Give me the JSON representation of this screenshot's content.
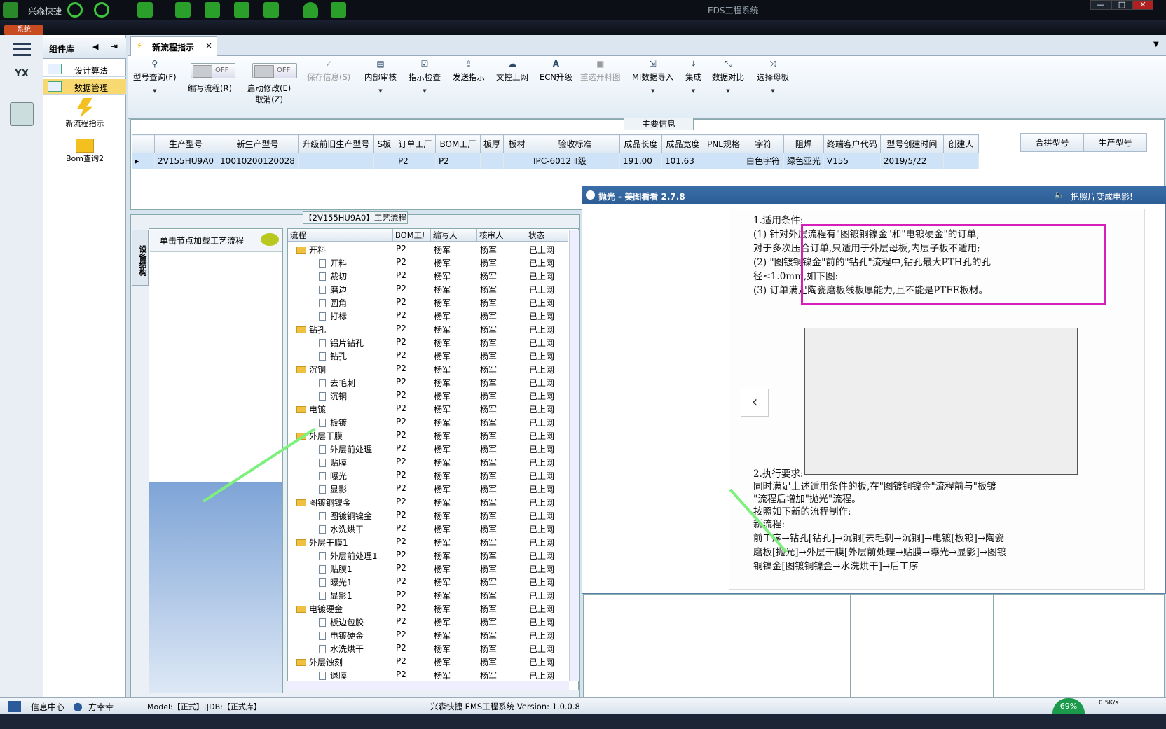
{
  "titlebar": {
    "brand": "兴森快捷",
    "app_title": "EDS工程系统",
    "win_min": "—",
    "win_max": "□",
    "win_close": "✕"
  },
  "menubar": {
    "system": "系统"
  },
  "sidebar": {
    "yx_label": "YX"
  },
  "component_panel": {
    "title": "组件库",
    "items": [
      {
        "label": "设计算法"
      },
      {
        "label": "数据管理"
      }
    ],
    "tools": [
      {
        "label": "新流程指示"
      },
      {
        "label": "Bom查询2"
      }
    ]
  },
  "tab": {
    "label": "新流程指示",
    "close": "×"
  },
  "toolbar": {
    "buttons": [
      {
        "label": "型号查询(F)"
      },
      {
        "label": "编写流程(R)",
        "toggle": "OFF"
      },
      {
        "label": "启动修改(E)",
        "sub": "取消(Z)",
        "toggle": "OFF"
      },
      {
        "label": "保存信息(S)"
      },
      {
        "label": "内部审核"
      },
      {
        "label": "指示检查"
      },
      {
        "label": "发送指示"
      },
      {
        "label": "文控上网"
      },
      {
        "label": "ECN升级"
      },
      {
        "label": "重选开料图"
      },
      {
        "label": "MI数据导入"
      },
      {
        "label": "集成"
      },
      {
        "label": "数据对比"
      },
      {
        "label": "选择母板"
      }
    ]
  },
  "main_info": {
    "label": "主要信息",
    "columns": [
      "生产型号",
      "新生产型号",
      "升级前旧生产型号",
      "S板",
      "订单工厂",
      "BOM工厂",
      "板厚",
      "板材",
      "验收标准",
      "成品长度",
      "成品宽度",
      "PNL规格",
      "字符",
      "阻焊",
      "终端客户代码",
      "型号创建时间",
      "创建人"
    ],
    "row": [
      "2V155HU9A0",
      "10010200120028",
      "",
      "",
      "P2",
      "P2",
      "",
      "",
      "IPC-6012 Ⅱ级",
      "191.00",
      "101.63",
      "",
      "白色字符",
      "绿色亚光",
      "V155",
      "2019/5/22",
      ""
    ],
    "side_columns": [
      "合拼型号",
      "生产型号"
    ]
  },
  "flow": {
    "label": "【2V155HU9A0】工艺流程",
    "vertical_tab": "设备结构",
    "hint": "单击节点加载工艺流程",
    "columns": [
      "流程",
      "BOM工厂",
      "编写人",
      "核审人",
      "状态"
    ],
    "rows": [
      {
        "name": "开料",
        "folder": true,
        "f": "P2",
        "w": "杨军",
        "c": "杨军",
        "s": "已上网"
      },
      {
        "name": "开料",
        "folder": false,
        "f": "P2",
        "w": "杨军",
        "c": "杨军",
        "s": "已上网"
      },
      {
        "name": "裁切",
        "folder": false,
        "f": "P2",
        "w": "杨军",
        "c": "杨军",
        "s": "已上网"
      },
      {
        "name": "磨边",
        "folder": false,
        "f": "P2",
        "w": "杨军",
        "c": "杨军",
        "s": "已上网"
      },
      {
        "name": "圆角",
        "folder": false,
        "f": "P2",
        "w": "杨军",
        "c": "杨军",
        "s": "已上网"
      },
      {
        "name": "打标",
        "folder": false,
        "f": "P2",
        "w": "杨军",
        "c": "杨军",
        "s": "已上网"
      },
      {
        "name": "钻孔",
        "folder": true,
        "f": "P2",
        "w": "杨军",
        "c": "杨军",
        "s": "已上网"
      },
      {
        "name": "铝片钻孔",
        "folder": false,
        "f": "P2",
        "w": "杨军",
        "c": "杨军",
        "s": "已上网"
      },
      {
        "name": "钻孔",
        "folder": false,
        "f": "P2",
        "w": "杨军",
        "c": "杨军",
        "s": "已上网"
      },
      {
        "name": "沉铜",
        "folder": true,
        "f": "P2",
        "w": "杨军",
        "c": "杨军",
        "s": "已上网"
      },
      {
        "name": "去毛刺",
        "folder": false,
        "f": "P2",
        "w": "杨军",
        "c": "杨军",
        "s": "已上网"
      },
      {
        "name": "沉铜",
        "folder": false,
        "f": "P2",
        "w": "杨军",
        "c": "杨军",
        "s": "已上网"
      },
      {
        "name": "电镀",
        "folder": true,
        "f": "P2",
        "w": "杨军",
        "c": "杨军",
        "s": "已上网"
      },
      {
        "name": "板镀",
        "folder": false,
        "f": "P2",
        "w": "杨军",
        "c": "杨军",
        "s": "已上网"
      },
      {
        "name": "外层干膜",
        "folder": true,
        "f": "P2",
        "w": "杨军",
        "c": "杨军",
        "s": "已上网"
      },
      {
        "name": "外层前处理",
        "folder": false,
        "f": "P2",
        "w": "杨军",
        "c": "杨军",
        "s": "已上网"
      },
      {
        "name": "贴膜",
        "folder": false,
        "f": "P2",
        "w": "杨军",
        "c": "杨军",
        "s": "已上网"
      },
      {
        "name": "曝光",
        "folder": false,
        "f": "P2",
        "w": "杨军",
        "c": "杨军",
        "s": "已上网"
      },
      {
        "name": "显影",
        "folder": false,
        "f": "P2",
        "w": "杨军",
        "c": "杨军",
        "s": "已上网"
      },
      {
        "name": "图镀铜镍金",
        "folder": true,
        "f": "P2",
        "w": "杨军",
        "c": "杨军",
        "s": "已上网"
      },
      {
        "name": "图镀铜镍金",
        "folder": false,
        "f": "P2",
        "w": "杨军",
        "c": "杨军",
        "s": "已上网"
      },
      {
        "name": "水洗烘干",
        "folder": false,
        "f": "P2",
        "w": "杨军",
        "c": "杨军",
        "s": "已上网"
      },
      {
        "name": "外层干膜1",
        "folder": true,
        "f": "P2",
        "w": "杨军",
        "c": "杨军",
        "s": "已上网"
      },
      {
        "name": "外层前处理1",
        "folder": false,
        "f": "P2",
        "w": "杨军",
        "c": "杨军",
        "s": "已上网"
      },
      {
        "name": "贴膜1",
        "folder": false,
        "f": "P2",
        "w": "杨军",
        "c": "杨军",
        "s": "已上网"
      },
      {
        "name": "曝光1",
        "folder": false,
        "f": "P2",
        "w": "杨军",
        "c": "杨军",
        "s": "已上网"
      },
      {
        "name": "显影1",
        "folder": false,
        "f": "P2",
        "w": "杨军",
        "c": "杨军",
        "s": "已上网"
      },
      {
        "name": "电镀硬金",
        "folder": true,
        "f": "P2",
        "w": "杨军",
        "c": "杨军",
        "s": "已上网"
      },
      {
        "name": "板边包胶",
        "folder": false,
        "f": "P2",
        "w": "杨军",
        "c": "杨军",
        "s": "已上网"
      },
      {
        "name": "电镀硬金",
        "folder": false,
        "f": "P2",
        "w": "杨军",
        "c": "杨军",
        "s": "已上网"
      },
      {
        "name": "水洗烘干",
        "folder": false,
        "f": "P2",
        "w": "杨军",
        "c": "杨军",
        "s": "已上网"
      },
      {
        "name": "外层蚀刻",
        "folder": true,
        "f": "P2",
        "w": "杨军",
        "c": "杨军",
        "s": "已上网"
      },
      {
        "name": "退膜",
        "folder": false,
        "f": "P2",
        "w": "杨军",
        "c": "杨军",
        "s": "已上网"
      }
    ]
  },
  "viewer": {
    "title": "抛光 - 美图看看 2.7.8",
    "ad": "把照片变成电影!",
    "prev": "‹",
    "doc_lines": [
      "1.适用条件:",
      "(1) 针对外层流程有\"图镀铜镍金\"和\"电镀硬金\"的订单,",
      "对于多次压合订单,只适用于外层母板,内层子板不适用;",
      "(2) \"图镀铜镍金\"前的\"钻孔\"流程中,钻孔最大PTH孔的孔",
      "径≤1.0mm,如下图:",
      "(3) 订单满足陶瓷磨板线板厚能力,且不能是PTFE板材。",
      "2.执行要求:",
      "同时满足上述适用条件的板,在\"图镀铜镍金\"流程前与\"板镀",
      "\"流程后增加\"抛光\"流程。",
      "按照如下新的流程制作:",
      "新流程:",
      "前工序→钻孔[钻孔]→沉铜[去毛刺→沉铜]→电镀[板镀]→陶瓷",
      "磨板[抛光]→外层干膜[外层前处理→贴膜→曝光→显影]→图镀",
      "铜镍金[图镀铜镍金→水洗烘干]→后工序"
    ]
  },
  "statusbar": {
    "info_center": "信息中心",
    "user": "方幸幸",
    "model_db": "Model:【正式】||DB:【正式库】",
    "version": "兴森快捷 EMS工程系统 Version: 1.0.0.8",
    "speed": "0.5K/s",
    "percent": "69%"
  },
  "colors": {
    "accent": "#2c5c94",
    "highlight": "#d61fb8",
    "arrow": "#7ef07e",
    "selected_row": "#cfe3f8"
  }
}
